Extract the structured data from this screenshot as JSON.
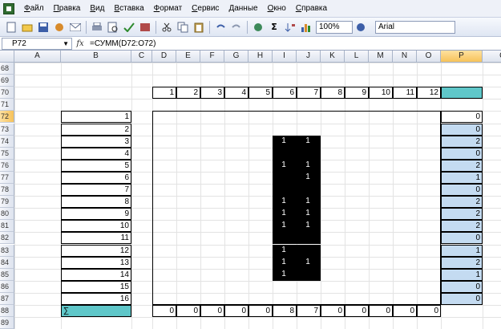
{
  "menu": {
    "items": [
      "Файл",
      "Правка",
      "Вид",
      "Вставка",
      "Формат",
      "Сервис",
      "Данные",
      "Окно",
      "Справка"
    ]
  },
  "toolbar": {
    "zoom": "100%",
    "font": "Arial"
  },
  "formula_bar": {
    "name_box": "P72",
    "fx": "fx",
    "formula": "=СУММ(D72:O72)"
  },
  "columns": [
    "A",
    "B",
    "C",
    "D",
    "E",
    "F",
    "G",
    "H",
    "I",
    "J",
    "K",
    "L",
    "M",
    "N",
    "O",
    "P",
    "Q"
  ],
  "rows": [
    "68",
    "69",
    "70",
    "71",
    "72",
    "73",
    "74",
    "75",
    "76",
    "77",
    "78",
    "79",
    "80",
    "81",
    "82",
    "83",
    "84",
    "85",
    "86",
    "87",
    "88",
    "89"
  ],
  "header_row_numbers": [
    "1",
    "2",
    "3",
    "4",
    "5",
    "6",
    "7",
    "8",
    "9",
    "10",
    "11",
    "12"
  ],
  "left_numbers": [
    "1",
    "2",
    "3",
    "4",
    "5",
    "6",
    "7",
    "8",
    "9",
    "10",
    "11",
    "12",
    "13",
    "14",
    "15",
    "16"
  ],
  "sigma": "∑",
  "black_cells": [
    {
      "row": 2,
      "col": 5,
      "text": "1"
    },
    {
      "row": 2,
      "col": 6,
      "text": "1"
    },
    {
      "row": 4,
      "col": 5,
      "text": "1"
    },
    {
      "row": 4,
      "col": 6,
      "text": "1"
    },
    {
      "row": 5,
      "col": 6,
      "text": "1"
    },
    {
      "row": 6,
      "col": 6,
      "text": ""
    },
    {
      "row": 7,
      "col": 5,
      "text": "1"
    },
    {
      "row": 7,
      "col": 6,
      "text": "1"
    },
    {
      "row": 8,
      "col": 5,
      "text": "1"
    },
    {
      "row": 8,
      "col": 6,
      "text": "1"
    },
    {
      "row": 9,
      "col": 5,
      "text": "1"
    },
    {
      "row": 9,
      "col": 6,
      "text": "1"
    },
    {
      "row": 11,
      "col": 5,
      "text": "1"
    },
    {
      "row": 12,
      "col": 5,
      "text": "1"
    },
    {
      "row": 12,
      "col": 6,
      "text": "1"
    },
    {
      "row": 13,
      "col": 5,
      "text": "1"
    }
  ],
  "black_fill_only": [
    {
      "row": 3,
      "col": 5
    },
    {
      "row": 3,
      "col": 6
    },
    {
      "row": 5,
      "col": 5
    },
    {
      "row": 6,
      "col": 5
    },
    {
      "row": 10,
      "col": 5
    },
    {
      "row": 10,
      "col": 6
    },
    {
      "row": 11,
      "col": 6
    },
    {
      "row": 13,
      "col": 6
    }
  ],
  "row_sums": [
    "0",
    "0",
    "2",
    "0",
    "2",
    "1",
    "0",
    "2",
    "2",
    "2",
    "0",
    "1",
    "2",
    "1",
    "0",
    "0"
  ],
  "column_sums": [
    "0",
    "0",
    "0",
    "0",
    "0",
    "8",
    "7",
    "0",
    "0",
    "0",
    "0",
    "0"
  ]
}
